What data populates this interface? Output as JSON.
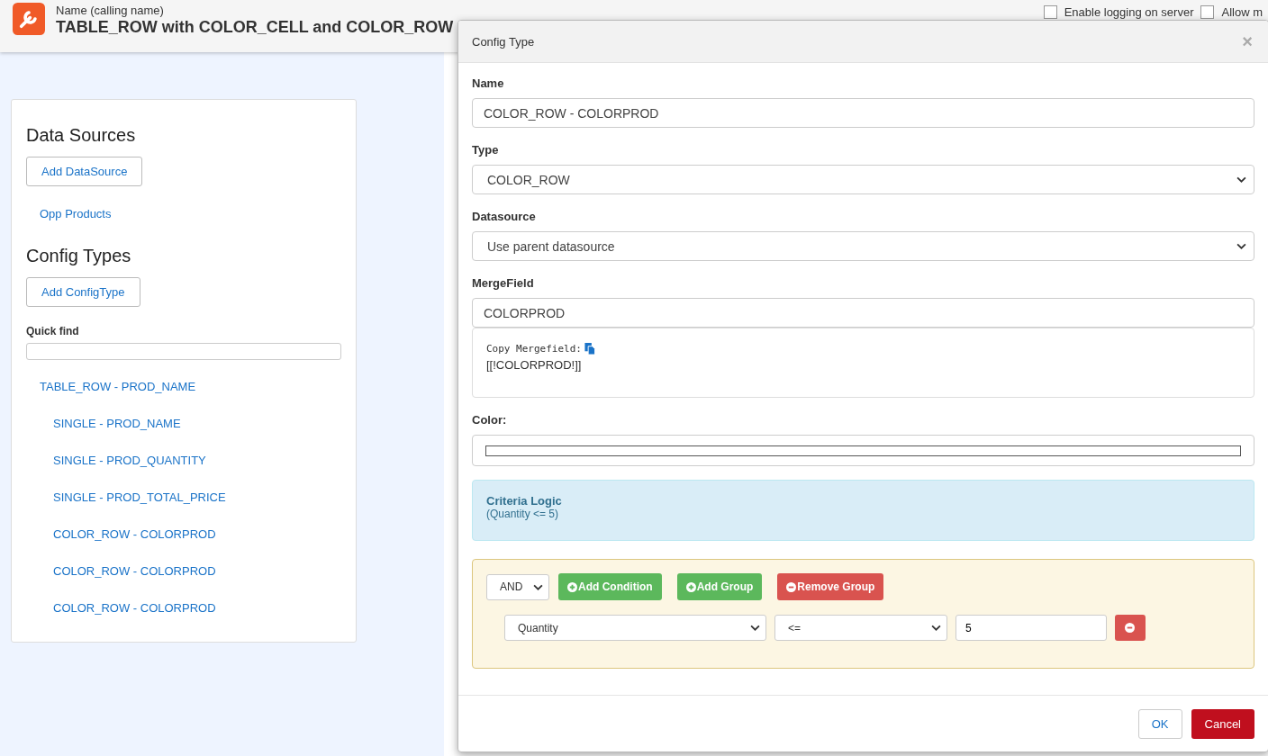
{
  "header": {
    "subtitle": "Name (calling name)",
    "title": "TABLE_ROW with COLOR_CELL and COLOR_ROW",
    "options": [
      {
        "label": "Enable logging on server",
        "checked": false
      },
      {
        "label": "Allow m",
        "checked": false
      }
    ]
  },
  "sidebar": {
    "data_sources_title": "Data Sources",
    "add_datasource": "Add DataSource",
    "data_sources": [
      "Opp Products"
    ],
    "config_types_title": "Config Types",
    "add_configtype": "Add ConfigType",
    "quick_find": {
      "label": "Quick find"
    },
    "tree": [
      {
        "label": "TABLE_ROW - PROD_NAME",
        "children": [
          {
            "label": "SINGLE - PROD_NAME"
          },
          {
            "label": "SINGLE - PROD_QUANTITY"
          },
          {
            "label": "SINGLE - PROD_TOTAL_PRICE"
          },
          {
            "label": "COLOR_ROW - COLORPROD"
          },
          {
            "label": "COLOR_ROW - COLORPROD"
          },
          {
            "label": "COLOR_ROW - COLORPROD"
          }
        ]
      }
    ]
  },
  "dialog": {
    "title": "Config Type",
    "close": "×",
    "name": {
      "label": "Name",
      "value": "COLOR_ROW - COLORPROD"
    },
    "type": {
      "label": "Type",
      "value": "COLOR_ROW"
    },
    "datasource": {
      "label": "Datasource",
      "value": "Use parent datasource"
    },
    "mergefield": {
      "label": "MergeField",
      "value": "COLORPROD",
      "copy_label": "Copy Mergefield:",
      "token": "[[!COLORPROD!]]"
    },
    "color": {
      "label": "Color:"
    },
    "criteria": {
      "title": "Criteria Logic",
      "expression": "(Quantity <= 5)"
    },
    "group": {
      "conjunction": "AND",
      "add_condition": "Add Condition",
      "add_group": "Add Group",
      "remove_group": "Remove Group",
      "rules": [
        {
          "field": "Quantity",
          "operator": "<=",
          "value": "5"
        }
      ]
    },
    "buttons": {
      "ok": "OK",
      "cancel": "Cancel"
    }
  }
}
